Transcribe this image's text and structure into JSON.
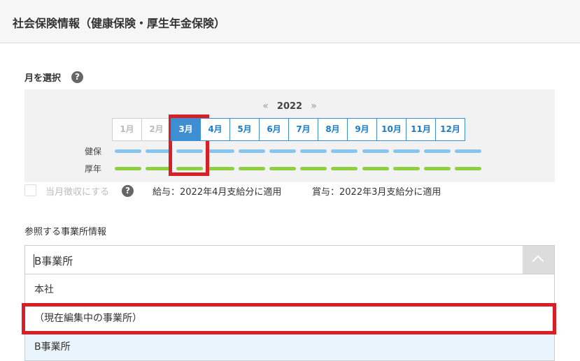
{
  "header": {
    "title": "社会保険情報（健康保険・厚生年金保険）"
  },
  "month_select": {
    "label": "月を選択",
    "help_icon": "question-circle-icon"
  },
  "year_nav": {
    "prev_symbol": "«",
    "year": "2022",
    "next_symbol": "»"
  },
  "months": [
    {
      "label": "1月",
      "state": "past"
    },
    {
      "label": "2月",
      "state": "past"
    },
    {
      "label": "3月",
      "state": "selected"
    },
    {
      "label": "4月",
      "state": "future"
    },
    {
      "label": "5月",
      "state": "future"
    },
    {
      "label": "6月",
      "state": "future"
    },
    {
      "label": "7月",
      "state": "future"
    },
    {
      "label": "8月",
      "state": "future"
    },
    {
      "label": "9月",
      "state": "future"
    },
    {
      "label": "10月",
      "state": "future"
    },
    {
      "label": "11月",
      "state": "future"
    },
    {
      "label": "12月",
      "state": "future"
    }
  ],
  "rows": {
    "kenpo_label": "健保",
    "kosei_label": "厚年"
  },
  "colors": {
    "kenpo_bar": "#87c4ee",
    "kosei_bar": "#8ccf3f",
    "accent": "#3d8fd1",
    "highlight_box": "#d81f26"
  },
  "collection": {
    "checkbox_label": "当月徴収にする",
    "checked": false,
    "salary_note": "給与：2022年4月支給分に適用",
    "bonus_note": "賞与：2022年3月支給分に適用"
  },
  "office_ref": {
    "label": "参照する事業所情報",
    "input_value": "B事業所",
    "options": [
      "本社",
      "（現在編集中の事業所）",
      "B事業所"
    ],
    "highlighted_option": "B事業所"
  }
}
